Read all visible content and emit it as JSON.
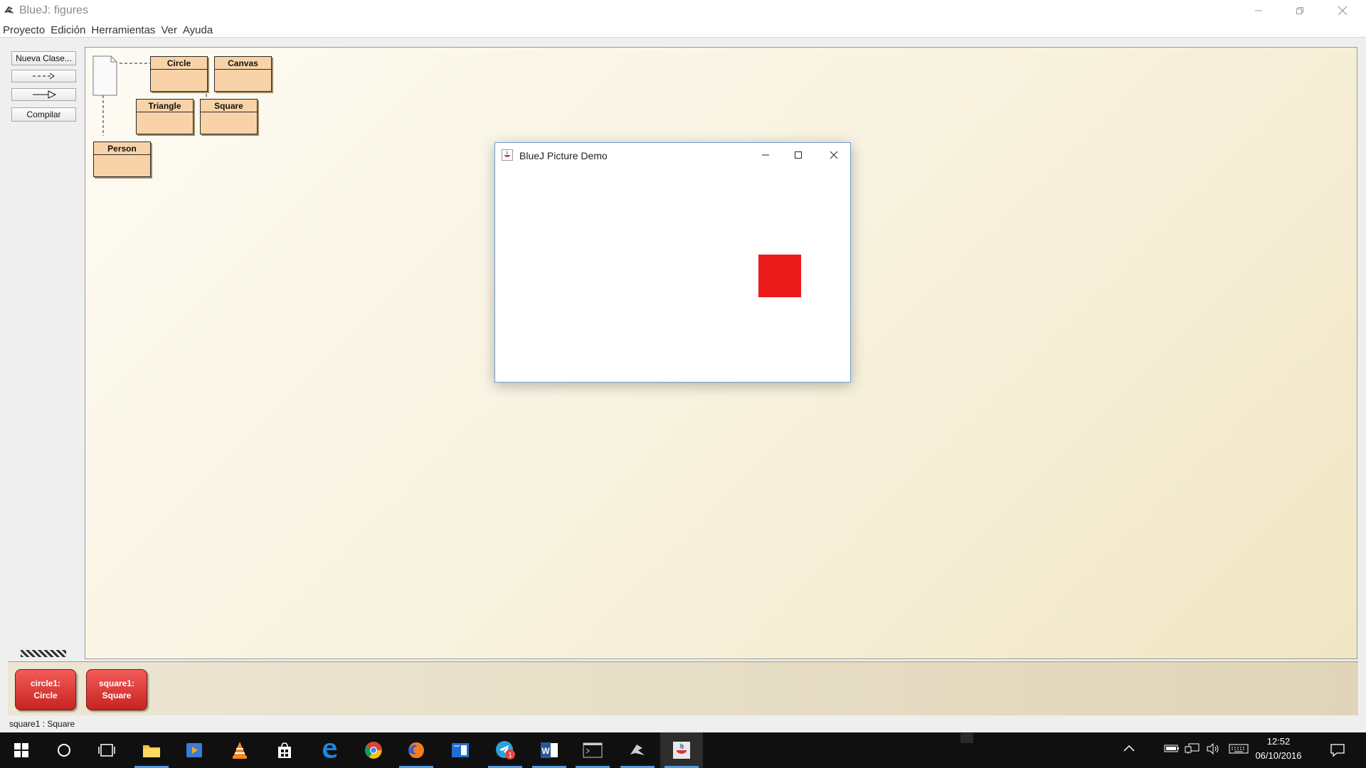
{
  "window": {
    "title": "BlueJ:  figures"
  },
  "menu": {
    "items": [
      "Proyecto",
      "Edición",
      "Herramientas",
      "Ver",
      "Ayuda"
    ]
  },
  "toolbar": {
    "new_class_label": "Nueva Clase...",
    "uses_arrow_label": "--->",
    "inherit_arrow_label": "—▷",
    "compile_label": "Compilar"
  },
  "diagram": {
    "classes": {
      "circle": "Circle",
      "canvas": "Canvas",
      "triangle": "Triangle",
      "square": "Square",
      "person": "Person"
    }
  },
  "bench": {
    "objects": [
      {
        "line1": "circle1:",
        "line2": "Circle"
      },
      {
        "line1": "square1:",
        "line2": "Square"
      }
    ]
  },
  "status": {
    "text": "square1 : Square"
  },
  "demo_window": {
    "title": "BlueJ Picture Demo",
    "shape_color": "#ec1b1b"
  },
  "taskbar": {
    "time": "12:52",
    "date": "06/10/2016",
    "badge_count": "1",
    "apps": [
      "start-icon",
      "cortana-icon",
      "task-view-icon",
      "file-explorer-icon",
      "media-player-icon",
      "vlc-icon",
      "store-icon",
      "edge-icon",
      "chrome-icon",
      "firefox-icon",
      "reader-icon",
      "telegram-icon",
      "word-icon",
      "terminal-icon",
      "bluej-icon",
      "java-icon"
    ]
  },
  "colors": {
    "class_fill": "#f9d3a8",
    "object_fill": "#d9302b",
    "accent": "#4d9be6"
  }
}
